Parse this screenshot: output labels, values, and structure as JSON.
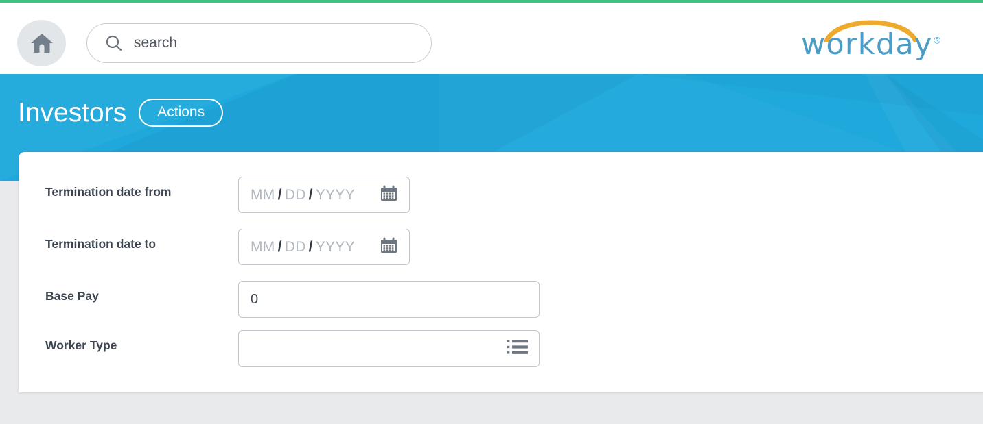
{
  "accents": {
    "top_strip": "#3fc380",
    "banner_blue": "#1fa8dc",
    "logo_arc": "#eeaa2d",
    "logo_text": "#4b9cc6",
    "label_text": "#3d4650"
  },
  "header": {
    "home_icon": "home-icon",
    "search": {
      "icon": "search-icon",
      "value": "",
      "placeholder": "search"
    },
    "logo": {
      "wordmark": "workday",
      "registered": "®",
      "arc_icon": "arc-icon"
    }
  },
  "banner": {
    "title": "Investors",
    "actions_label": "Actions"
  },
  "form": {
    "rows": [
      {
        "label": "Termination date from",
        "type": "date",
        "mm": "MM",
        "dd": "DD",
        "yyyy": "YYYY",
        "sep": "/",
        "icon": "calendar-icon"
      },
      {
        "label": "Termination date to",
        "type": "date",
        "mm": "MM",
        "dd": "DD",
        "yyyy": "YYYY",
        "sep": "/",
        "icon": "calendar-icon"
      },
      {
        "label": "Base Pay",
        "type": "text",
        "value": "0",
        "placeholder": ""
      },
      {
        "label": "Worker Type",
        "type": "prompt",
        "value": "",
        "placeholder": "",
        "icon": "list-prompt-icon"
      }
    ]
  }
}
